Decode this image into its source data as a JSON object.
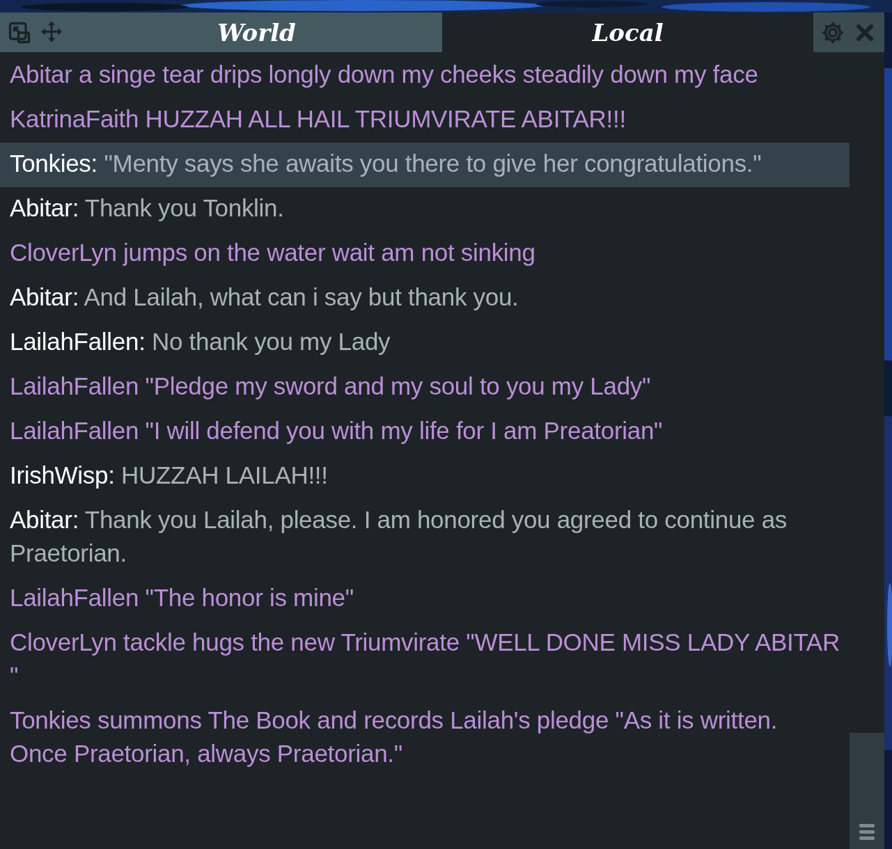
{
  "tabs": [
    {
      "label": "World",
      "selected": false
    },
    {
      "label": "Local",
      "selected": true
    }
  ],
  "messages": [
    {
      "kind": "emote",
      "text": "Abitar a singe tear drips longly down my cheeks steadily down my face",
      "highlighted": false
    },
    {
      "kind": "emote",
      "text": "KatrinaFaith HUZZAH  ALL HAIL TRIUMVIRATE ABITAR!!!",
      "highlighted": false
    },
    {
      "kind": "say",
      "speaker": "Tonkies:",
      "text": "\"Menty says she awaits you there to give her congratulations.\"",
      "highlighted": true
    },
    {
      "kind": "say",
      "speaker": "Abitar:",
      "text": "Thank you Tonklin.",
      "highlighted": false
    },
    {
      "kind": "emote",
      "text": "CloverLyn jumps on the water wait am not sinking",
      "highlighted": false
    },
    {
      "kind": "say",
      "speaker": "Abitar:",
      "text": "And Lailah, what can i say but thank you.",
      "highlighted": false
    },
    {
      "kind": "say",
      "speaker": "LailahFallen:",
      "text": "No thank you my Lady",
      "highlighted": false
    },
    {
      "kind": "emote",
      "text": "LailahFallen \"Pledge my sword and my soul to you my Lady\"",
      "highlighted": false
    },
    {
      "kind": "emote",
      "text": "LailahFallen \"I will defend you with my life for I am Preatorian\"",
      "highlighted": false
    },
    {
      "kind": "say",
      "speaker": "IrishWisp:",
      "text": "HUZZAH LAILAH!!!",
      "highlighted": false
    },
    {
      "kind": "say",
      "speaker": "Abitar:",
      "text": "Thank you Lailah, please. I am honored you agreed to continue as Praetorian.",
      "highlighted": false
    },
    {
      "kind": "emote",
      "text": "LailahFallen \"The honor is mine\"",
      "highlighted": false
    },
    {
      "kind": "emote",
      "text": "CloverLyn tackle hugs the new Triumvirate \"WELL DONE MISS LADY ABITAR \"",
      "highlighted": false
    },
    {
      "kind": "emote",
      "text": "Tonkies summons The Book and records Lailah's pledge \"As it is written. Once Praetorian, always Praetorian.\"",
      "highlighted": false
    }
  ]
}
